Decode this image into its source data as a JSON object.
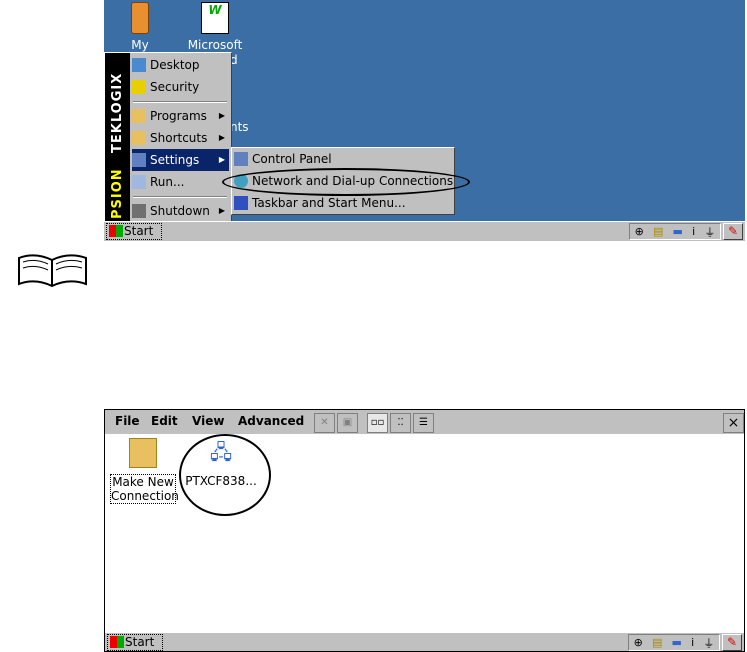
{
  "top_screenshot": {
    "desktop_icons": [
      {
        "label": "My Device"
      },
      {
        "label": "Microsoft",
        "label2": "d"
      }
    ],
    "hidden_text": "nts",
    "brand_band": {
      "top": "TEKLOGIX",
      "bottom": "PSION"
    },
    "start_menu": [
      {
        "label": "Desktop"
      },
      {
        "label": "Security"
      },
      {
        "label": "Programs"
      },
      {
        "label": "Shortcuts"
      },
      {
        "label": "Settings"
      },
      {
        "label": "Run..."
      },
      {
        "label": "Shutdown"
      }
    ],
    "settings_submenu": [
      {
        "label": "Control Panel"
      },
      {
        "label": "Network and Dial-up Connections"
      },
      {
        "label": "Taskbar and Start Menu..."
      }
    ],
    "taskbar": {
      "start": "Start"
    }
  },
  "bottom_screenshot": {
    "menu": [
      "File",
      "Edit",
      "View",
      "Advanced"
    ],
    "close": "×",
    "items": [
      {
        "label": "Make New Connection"
      },
      {
        "label": "PTXCF838..."
      }
    ],
    "taskbar": {
      "start": "Start"
    }
  },
  "colors": {
    "desktop": "#3a6ea5",
    "highlight": "#0a246a"
  }
}
